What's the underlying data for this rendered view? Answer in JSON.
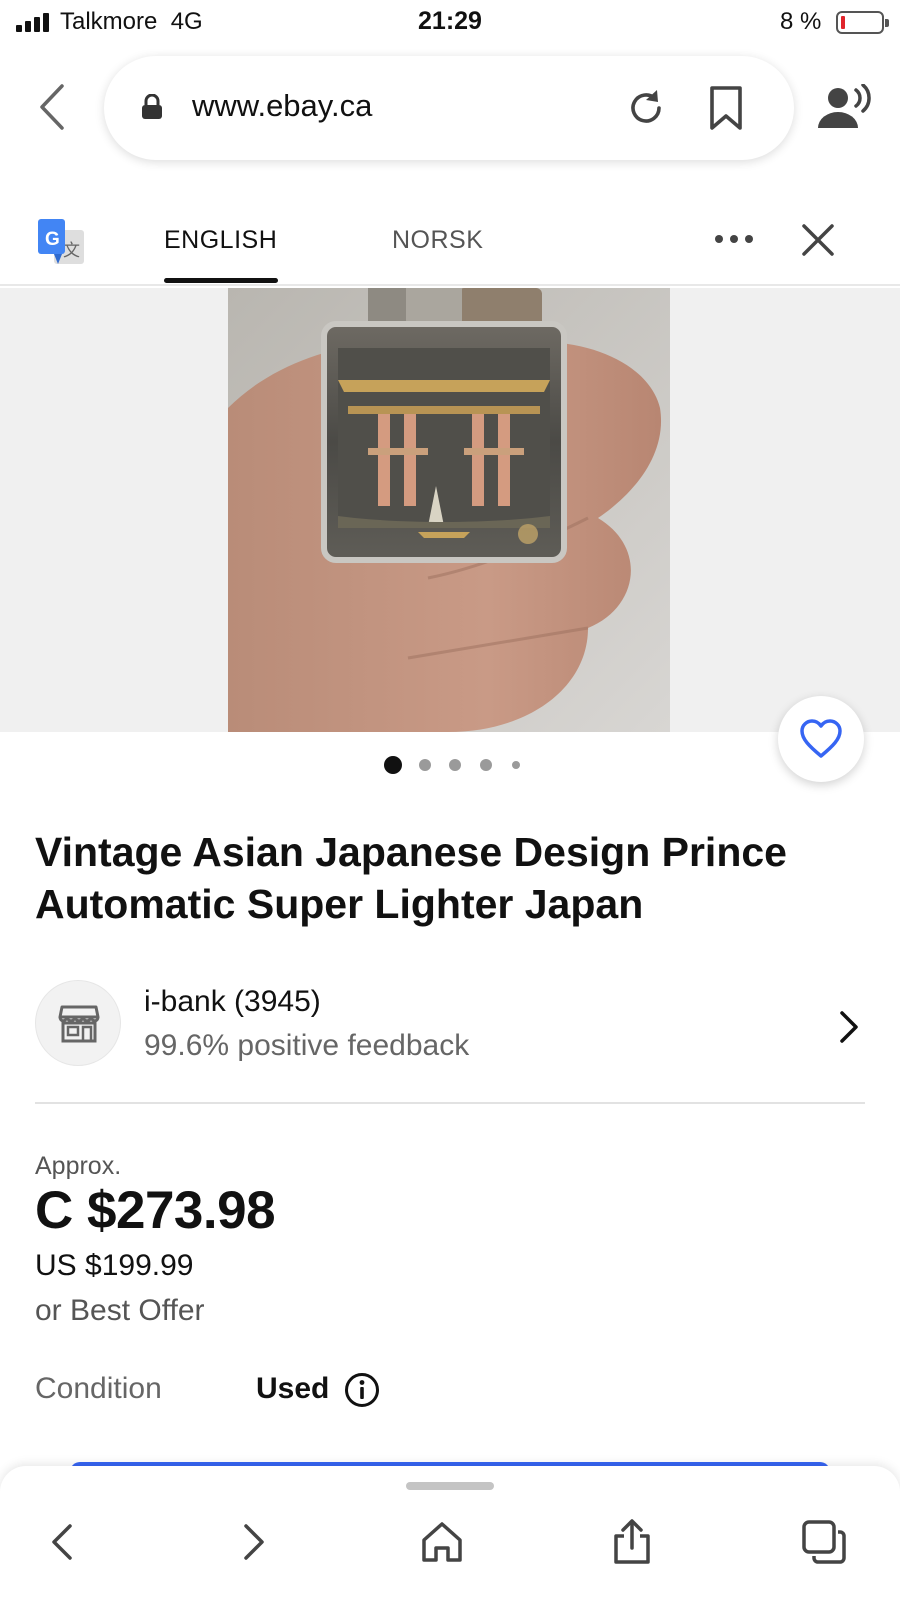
{
  "status_bar": {
    "carrier": "Talkmore",
    "network": "4G",
    "time": "21:29",
    "battery": "8 %",
    "battery_level": 0.08,
    "battery_color": "#e0242b"
  },
  "browser": {
    "url": "www.ebay.ca",
    "icons": [
      "back-arrow-icon",
      "lock-icon",
      "reload-icon",
      "bookmark-icon",
      "listen-icon"
    ]
  },
  "translate_bar": {
    "tabs": [
      "ENGLISH",
      "NORSK"
    ],
    "active_tab": "ENGLISH",
    "icons": [
      "google-translate-icon",
      "more-icon",
      "close-icon"
    ]
  },
  "gallery": {
    "image_count": 5,
    "current_index": 0,
    "favorite_color": "#3665f3"
  },
  "listing": {
    "title": "Vintage Asian Japanese Design Prince Automatic Super Lighter Japan",
    "seller": {
      "name": "i-bank (3945)",
      "feedback": "99.6% positive feedback"
    },
    "price": {
      "approx_label": "Approx.",
      "main": "C $273.98",
      "original": "US $199.99",
      "offer": "or Best Offer"
    },
    "condition": {
      "label": "Condition",
      "value": "Used"
    }
  },
  "toolbar": {
    "icons": [
      "back-icon",
      "forward-icon",
      "home-icon",
      "share-icon",
      "tabs-icon"
    ],
    "accent": "#3665f3"
  }
}
